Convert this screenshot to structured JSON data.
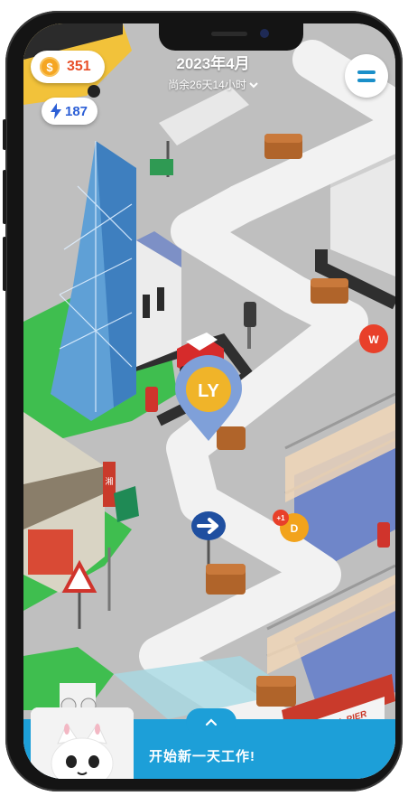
{
  "status": {
    "coins": "351",
    "energy": "187"
  },
  "header": {
    "title": "2023年4月",
    "subtitle": "尚余26天14小时"
  },
  "map": {
    "player_marker": "LY",
    "players": [
      "W",
      "D"
    ],
    "player_d_badge": "+1",
    "pier_sign": "CENTRAL PIER",
    "shop_sign": "湘"
  },
  "bottom_panel": {
    "message": "开始新一天工作!"
  },
  "colors": {
    "road": "#f2f2f2",
    "grass": "#3fbe4f",
    "accent": "#1d9fd8",
    "coin": "#f5a623",
    "energy": "#2c5fd6",
    "marker": "#f0b429"
  }
}
